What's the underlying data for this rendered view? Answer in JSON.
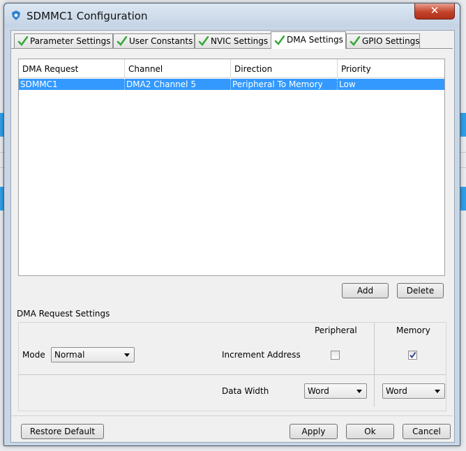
{
  "window": {
    "title": "SDMMC1 Configuration",
    "close_label": "✕"
  },
  "tabs": [
    {
      "label": "Parameter Settings",
      "active": false
    },
    {
      "label": "User Constants",
      "active": false
    },
    {
      "label": "NVIC Settings",
      "active": false
    },
    {
      "label": "DMA Settings",
      "active": true
    },
    {
      "label": "GPIO Settings",
      "active": false
    }
  ],
  "table": {
    "columns": [
      "DMA Request",
      "Channel",
      "Direction",
      "Priority"
    ],
    "rows": [
      {
        "request": "SDMMC1",
        "channel": "DMA2 Channel 5",
        "direction": "Peripheral To Memory",
        "priority": "Low",
        "selected": true
      }
    ]
  },
  "table_buttons": {
    "add": "Add",
    "delete": "Delete"
  },
  "request_settings": {
    "title": "DMA Request Settings",
    "peripheral_header": "Peripheral",
    "memory_header": "Memory",
    "mode_label": "Mode",
    "mode_value": "Normal",
    "increment_label": "Increment Address",
    "increment_peripheral": false,
    "increment_memory": true,
    "data_width_label": "Data Width",
    "data_width_peripheral": "Word",
    "data_width_memory": "Word"
  },
  "footer": {
    "restore": "Restore Default",
    "apply": "Apply",
    "ok": "Ok",
    "cancel": "Cancel"
  },
  "colors": {
    "selection": "#3399ff",
    "check": "#3aa83a",
    "close": "#c3432b"
  }
}
